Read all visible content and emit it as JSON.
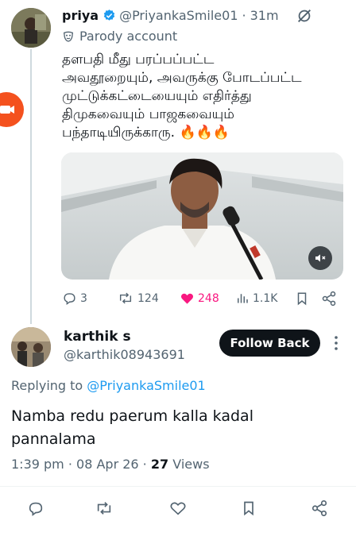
{
  "parent_tweet": {
    "display_name": "priya",
    "handle": "@PriyankaSmile01",
    "separator": "·",
    "time_ago": "31m",
    "parody_label": "Parody account",
    "text_lines": [
      "தளபதி மீது பரப்பப்பட்ட",
      "அவதூறையும், அவருக்கு போடப்பட்ட",
      "முட்டுக்கட்டையையும் எதிர்த்து",
      "திமுகவையும் பாஜகவையும்",
      "பந்தாடியிருக்காரு. 🔥🔥🔥"
    ],
    "actions": {
      "replies": "3",
      "reposts": "124",
      "likes": "248",
      "views": "1.1K"
    },
    "like_color": "#f91880"
  },
  "reply": {
    "display_name": "karthik s",
    "handle": "@karthik08943691",
    "follow_label": "Follow Back",
    "replying_to_prefix": "Replying to",
    "replying_to_handle": "@PriyankaSmile01",
    "text_lines": [
      "Namba redu paerum kalla kadal",
      "pannalama"
    ],
    "timestamp": "1:39 pm · 08 Apr 26 ·",
    "views_count": "27",
    "views_label": "Views"
  },
  "colors": {
    "accent": "#1d9bf0",
    "muted": "#536471",
    "verified": "#1d9bf0",
    "fab": "#f4511e"
  },
  "icons": [
    "verified-icon",
    "grok-icon",
    "mask-icon",
    "volume-icon",
    "reply-icon",
    "repost-icon",
    "like-icon",
    "views-icon",
    "bookmark-icon",
    "share-icon",
    "more-icon",
    "video-call-icon"
  ]
}
